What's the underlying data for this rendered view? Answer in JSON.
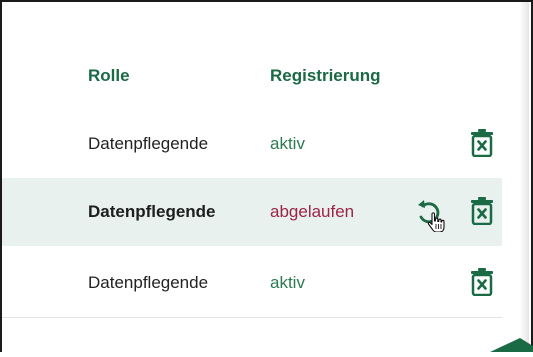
{
  "table": {
    "headers": {
      "role": "Rolle",
      "registration": "Registrierung"
    },
    "rows": [
      {
        "role": "Datenpflegende",
        "status": "aktiv",
        "status_color": "#2c7a4f",
        "highlighted": false
      },
      {
        "role": "Datenpflegende",
        "status": "abgelaufen",
        "status_color": "#9b2448",
        "highlighted": true
      },
      {
        "role": "Datenpflegende",
        "status": "aktiv",
        "status_color": "#2c7a4f",
        "highlighted": false
      }
    ]
  },
  "icons": {
    "delete": "trash-icon",
    "restore": "restore-icon",
    "cursor": "hand-pointer-icon"
  },
  "colors": {
    "accent": "#1a6a46",
    "active": "#2c7a4f",
    "expired": "#9b2448",
    "row_highlight": "#e8f1ee"
  }
}
